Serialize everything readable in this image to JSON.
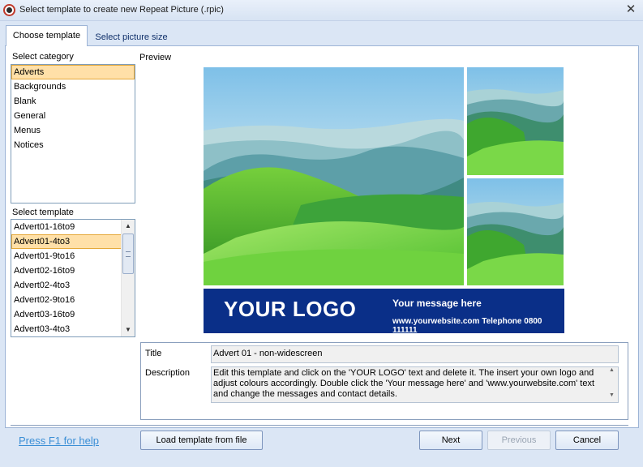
{
  "window": {
    "title": "Select template to create new Repeat Picture (.rpic)",
    "close_label": "✕"
  },
  "tabs": [
    {
      "label": "Choose template",
      "active": true
    },
    {
      "label": "Select picture size",
      "active": false
    }
  ],
  "category": {
    "label": "Select category",
    "items": [
      "Adverts",
      "Backgrounds",
      "Blank",
      "General",
      "Menus",
      "Notices"
    ],
    "selected": "Adverts"
  },
  "template": {
    "label": "Select template",
    "items": [
      "Advert01-16to9",
      "Advert01-4to3",
      "Advert01-9to16",
      "Advert02-16to9",
      "Advert02-4to3",
      "Advert02-9to16",
      "Advert03-16to9",
      "Advert03-4to3"
    ],
    "selected": "Advert01-4to3",
    "scroll_up": "▲",
    "scroll_down": "▼"
  },
  "preview": {
    "label": "Preview",
    "logo_text": "YOUR LOGO",
    "message": "Your message here",
    "contact": "www.yourwebsite.com  Telephone 0800 111111",
    "banner_color": "#0a2f88"
  },
  "info": {
    "title_label": "Title",
    "title_value": "Advert 01 - non-widescreen",
    "description_label": "Description",
    "description_value": "Edit this template and click on the 'YOUR LOGO' text and delete it.  The insert your own logo and adjust colours accordingly.  Double click the 'Your message here' and 'www.yourwebsite.com' text and change the messages and contact details."
  },
  "footer": {
    "help_link": "Press F1 for help",
    "load_button": "Load template from file",
    "next_button": "Next",
    "previous_button": "Previous",
    "cancel_button": "Cancel"
  },
  "colors": {
    "selection_fill": "#ffe0a8",
    "link": "#3b8fd6"
  }
}
